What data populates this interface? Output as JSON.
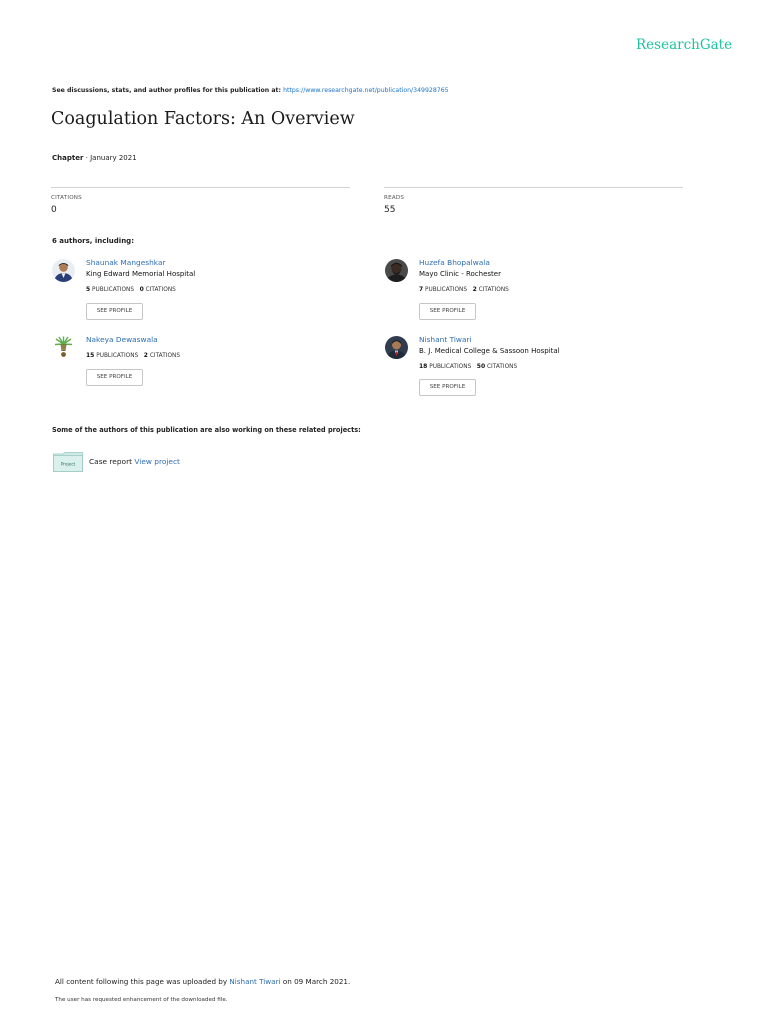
{
  "header": {
    "brand": "ResearchGate",
    "discussion_text": "See discussions, stats, and author profiles for this publication at:",
    "publication_url": "https://www.researchgate.net/publication/349928765"
  },
  "publication": {
    "title": "Coagulation Factors: An Overview",
    "type": "Chapter",
    "separator": " · ",
    "date": "January 2021"
  },
  "stats": {
    "citations_label": "CITATIONS",
    "citations_value": "0",
    "reads_label": "READS",
    "reads_value": "55"
  },
  "authors_heading": "6 authors, including:",
  "authors": [
    {
      "name": "Shaunak Mangeshkar",
      "institution": "King Edward Memorial Hospital",
      "publications": "5",
      "publications_label": "PUBLICATIONS",
      "citations": "0",
      "citations_label": "CITATIONS",
      "button": "SEE PROFILE"
    },
    {
      "name": "Huzefa Bhopalwala",
      "institution": "Mayo Clinic - Rochester",
      "publications": "7",
      "publications_label": "PUBLICATIONS",
      "citations": "2",
      "citations_label": "CITATIONS",
      "button": "SEE PROFILE"
    },
    {
      "name": "Nakeya Dewaswala",
      "institution": "",
      "publications": "15",
      "publications_label": "PUBLICATIONS",
      "citations": "2",
      "citations_label": "CITATIONS",
      "button": "SEE PROFILE"
    },
    {
      "name": "Nishant Tiwari",
      "institution": "B. J. Medical College & Sassoon Hospital",
      "publications": "18",
      "publications_label": "PUBLICATIONS",
      "citations": "50",
      "citations_label": "CITATIONS",
      "button": "SEE PROFILE"
    }
  ],
  "projects": {
    "heading": "Some of the authors of this publication are also working on these related projects:",
    "icon_label": "Project",
    "items": [
      {
        "name": "Case report",
        "link": "View project"
      }
    ]
  },
  "footer": {
    "uploaded_prefix": "All content following this page was uploaded by",
    "uploader": "Nishant Tiwari",
    "uploaded_suffix": "on 09 March 2021.",
    "note": "The user has requested enhancement of the downloaded file."
  },
  "colors": {
    "brand": "#20c2a3",
    "link": "#2c6db5"
  }
}
